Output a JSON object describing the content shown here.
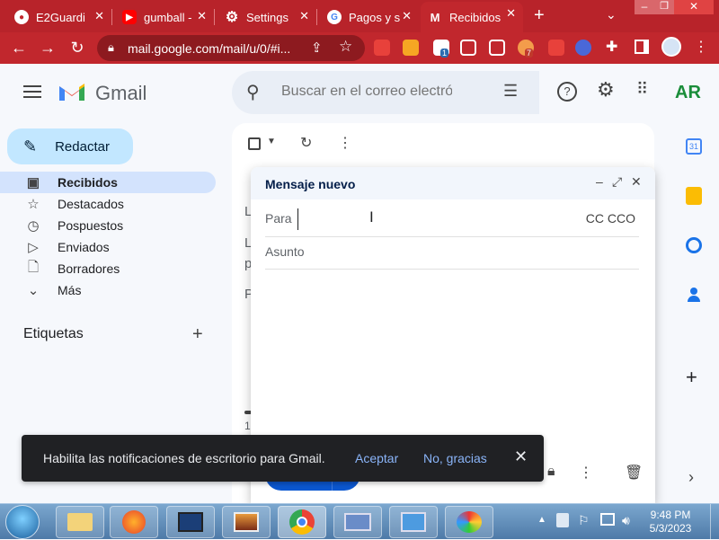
{
  "browser": {
    "tabs": [
      {
        "title": "E2Guardi",
        "favicon": "globe-icon",
        "active": false
      },
      {
        "title": "gumball -",
        "favicon": "youtube-icon",
        "active": false
      },
      {
        "title": "Settings",
        "favicon": "gear-icon",
        "active": false
      },
      {
        "title": "Pagos y s",
        "favicon": "google-icon",
        "active": false
      },
      {
        "title": "Recibidos",
        "favicon": "gmail-icon",
        "active": true
      }
    ],
    "new_tab": "+",
    "url": "mail.google.com/mail/u/0/#i...",
    "extension_badges": {
      "first": "1",
      "second": "7"
    }
  },
  "gmail": {
    "brand": "Gmail",
    "search_placeholder": "Buscar en el correo electrónico",
    "avatar": "AR",
    "compose_label": "Redactar",
    "nav": [
      {
        "label": "Recibidos",
        "icon": "inbox-icon",
        "active": true
      },
      {
        "label": "Destacados",
        "icon": "star-icon",
        "active": false
      },
      {
        "label": "Pospuestos",
        "icon": "clock-icon",
        "active": false
      },
      {
        "label": "Enviados",
        "icon": "send-icon",
        "active": false
      },
      {
        "label": "Borradores",
        "icon": "draft-icon",
        "active": false
      },
      {
        "label": "Más",
        "icon": "chevron-down-icon",
        "active": false
      }
    ],
    "labels_title": "Etiquetas",
    "list_peek": [
      "L",
      "L",
      "p",
      "P",
      "1."
    ]
  },
  "compose": {
    "title": "Mensaje nuevo",
    "to_label": "Para",
    "cc_bcc": "CC CCO",
    "subject_placeholder": "Asunto"
  },
  "snackbar": {
    "text": "Habilita las notificaciones de escritorio para Gmail.",
    "accept": "Aceptar",
    "decline": "No, gracias"
  },
  "taskbar": {
    "time": "9:48 PM",
    "date": "5/3/2023"
  },
  "colors": {
    "chrome_theme": "#c1272d",
    "compose_button": "#c2e7ff",
    "active_nav": "#d3e3fd",
    "link": "#8ab4f8"
  }
}
